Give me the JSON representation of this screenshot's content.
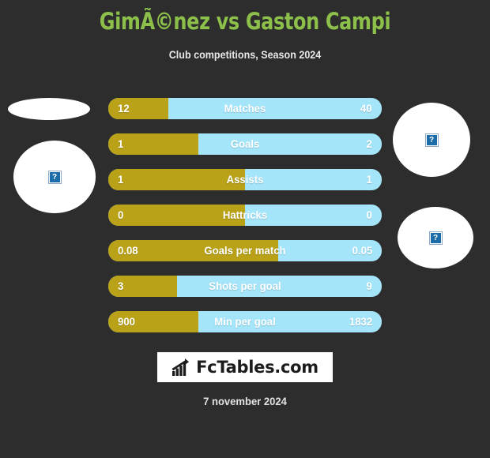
{
  "header": {
    "title": "GimÃ©nez vs Gaston Campi",
    "subtitle": "Club competitions, Season 2024"
  },
  "colors": {
    "background": "#2d2d2d",
    "title_green": "#8cc04a",
    "home_gold": "#b9a118",
    "away_blue": "#a5e5fa",
    "text_white": "#ffffff",
    "logo_background": "#ffffff",
    "logo_text": "#1c1c1c"
  },
  "photos": [
    {
      "name": "player-photo-left-top",
      "placeholder_icon": "broken-image-icon",
      "glyph": "?"
    },
    {
      "name": "player-photo-left-bottom",
      "placeholder_icon": "broken-image-icon",
      "glyph": "?"
    },
    {
      "name": "player-photo-right-top",
      "placeholder_icon": "broken-image-icon",
      "glyph": "?"
    },
    {
      "name": "player-photo-right-bottom",
      "placeholder_icon": "broken-image-icon",
      "glyph": "?"
    }
  ],
  "chart_data": {
    "type": "bar",
    "title": "GimÃ©nez vs Gaston Campi",
    "subtitle": "Club competitions, Season 2024",
    "orientation": "horizontal-diverging",
    "series": [
      {
        "name": "GimÃ©nez",
        "color": "#b9a118",
        "values": [
          12,
          1,
          1,
          0,
          0.08,
          3,
          900
        ]
      },
      {
        "name": "Gaston Campi",
        "color": "#a5e5fa",
        "values": [
          40,
          2,
          1,
          0,
          0.05,
          9,
          1832
        ]
      }
    ],
    "categories": [
      "Matches",
      "Goals",
      "Assists",
      "Hattricks",
      "Goals per match",
      "Shots per goal",
      "Min per goal"
    ],
    "rows": [
      {
        "label": "Matches",
        "home": "12",
        "away": "40",
        "home_pct": 22
      },
      {
        "label": "Goals",
        "home": "1",
        "away": "2",
        "home_pct": 33
      },
      {
        "label": "Assists",
        "home": "1",
        "away": "1",
        "home_pct": 50
      },
      {
        "label": "Hattricks",
        "home": "0",
        "away": "0",
        "home_pct": 50
      },
      {
        "label": "Goals per match",
        "home": "0.08",
        "away": "0.05",
        "home_pct": 62
      },
      {
        "label": "Shots per goal",
        "home": "3",
        "away": "9",
        "home_pct": 25
      },
      {
        "label": "Min per goal",
        "home": "900",
        "away": "1832",
        "home_pct": 33
      }
    ],
    "xlabel": "",
    "ylabel": "",
    "grid": false,
    "legend": "none"
  },
  "logo": {
    "icon": "bar-chart-growth-icon",
    "text": "FcTables.com"
  },
  "footer": {
    "date": "7 november 2024"
  }
}
